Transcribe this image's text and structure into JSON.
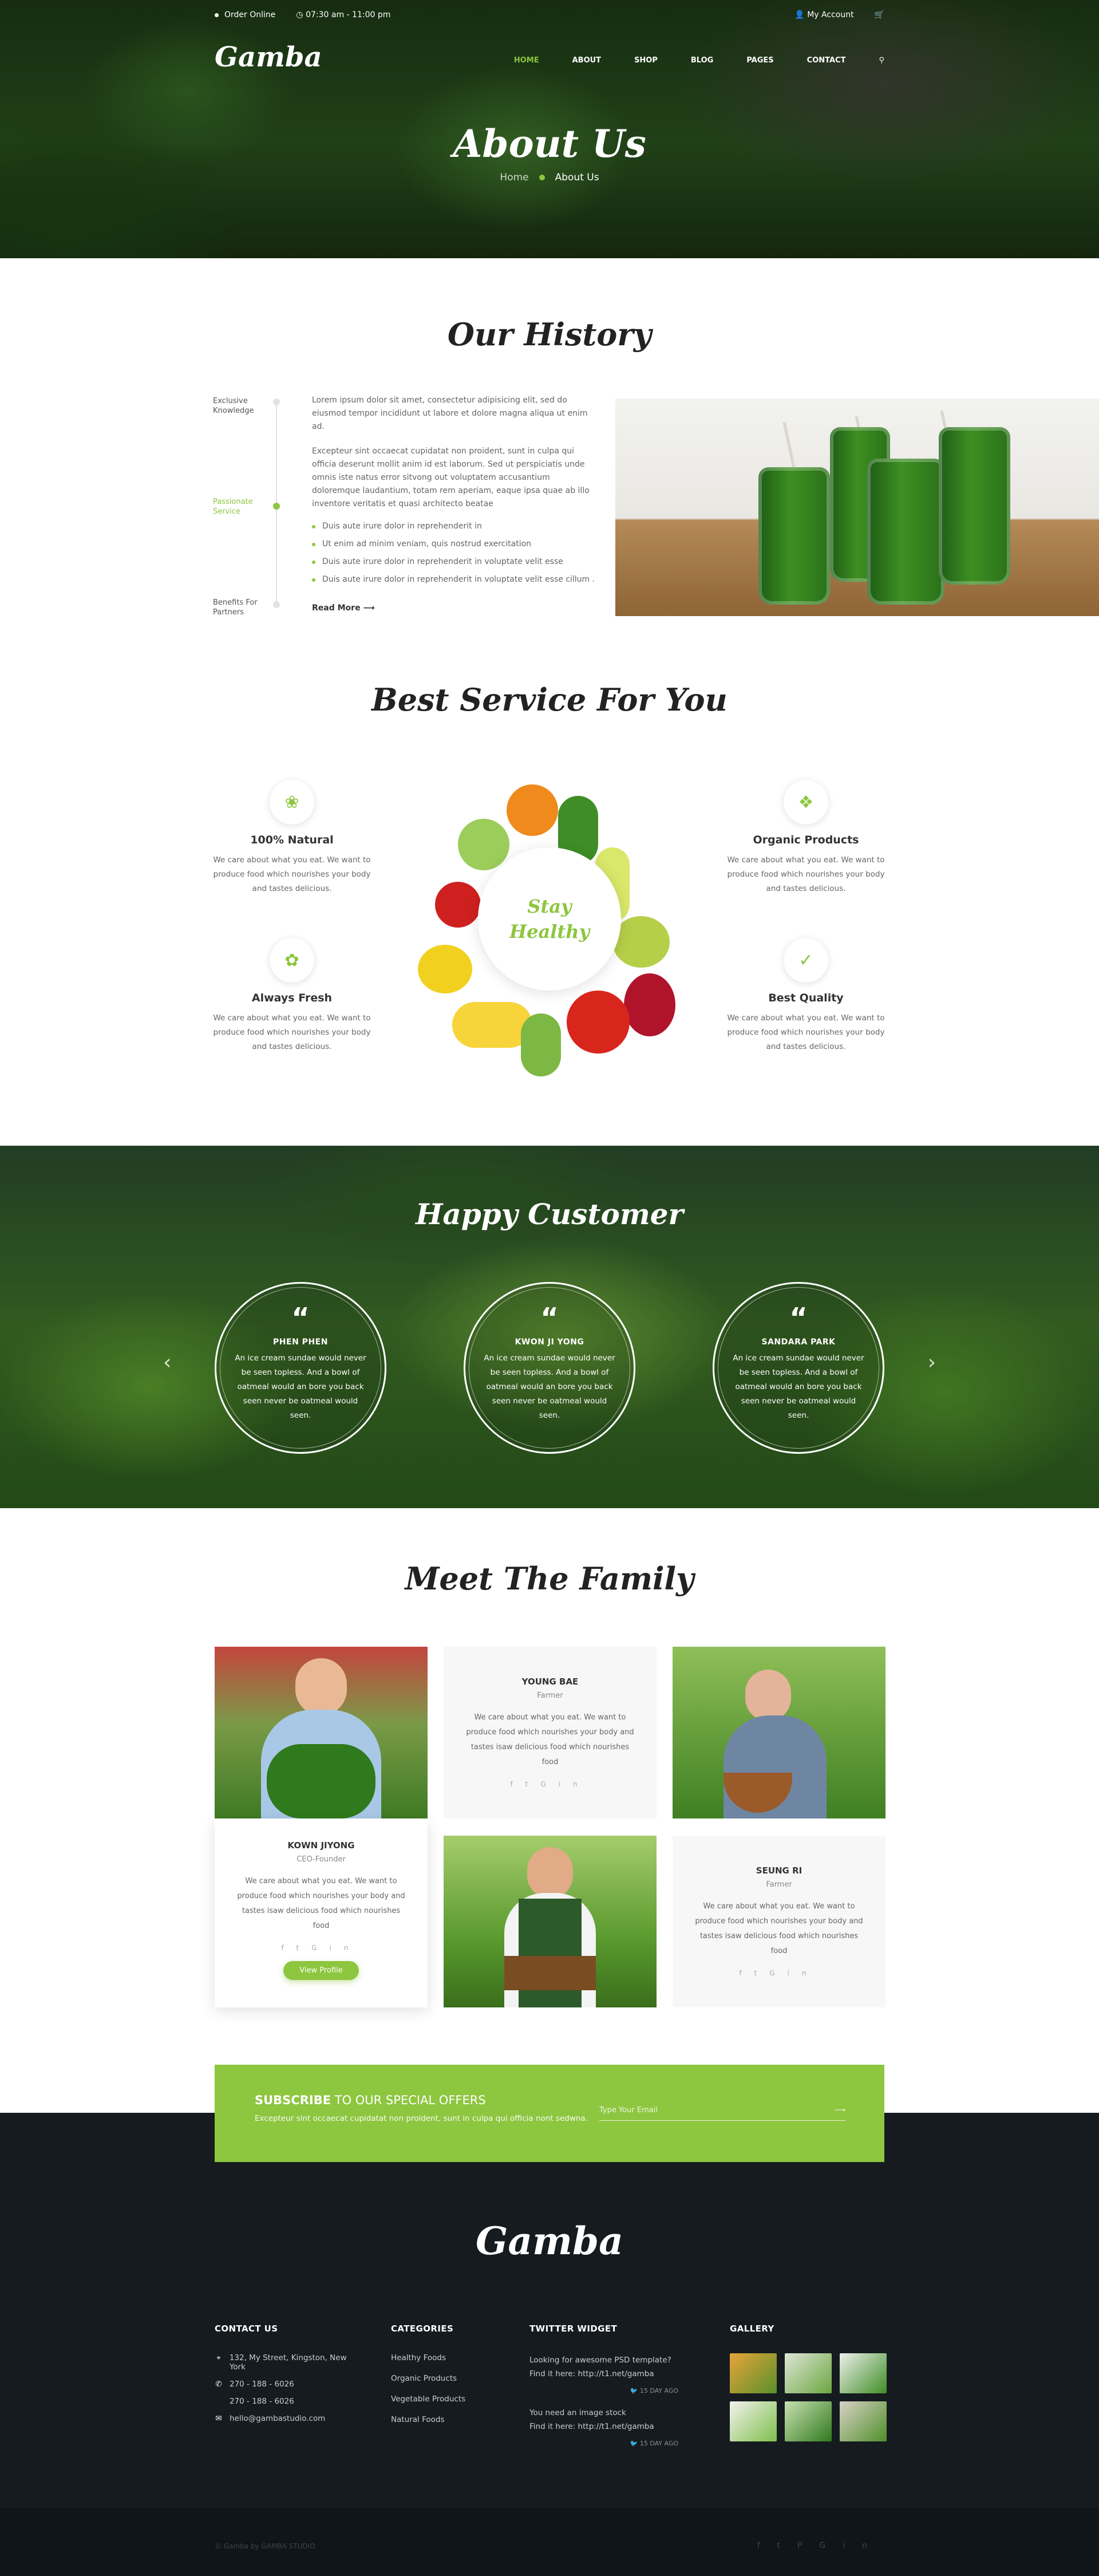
{
  "topbar": {
    "order_online": "Order Online",
    "hours": "07:30 am - 11:00 pm",
    "account": "My Account"
  },
  "brand": {
    "logo": "Gamba"
  },
  "nav": {
    "items": [
      "HOME",
      "ABOUT",
      "SHOP",
      "BLOG",
      "PAGES",
      "CONTACT"
    ],
    "active": "HOME"
  },
  "hero": {
    "title": "About Us",
    "crumb_home": "Home",
    "crumb_current": "About Us"
  },
  "history": {
    "title": "Our History",
    "timeline": [
      "Exclusive Knowledge",
      "Passionate Service",
      "Benefits For Partners"
    ],
    "timeline_active": "Passionate Service",
    "p1": "Lorem ipsum dolor sit amet, consectetur adipisicing elit, sed do eiusmod tempor incididunt ut labore et dolore magna aliqua ut enim ad.",
    "p2": "Excepteur sint occaecat cupidatat non proident, sunt in culpa qui officia deserunt mollit anim id est laborum. Sed ut perspiciatis unde omnis iste natus error sitvong out voluptatem accusantium doloremque laudantium, totam rem aperiam, eaque ipsa quae ab illo inventore veritatis et quasi architecto beatae",
    "bullets": [
      "Duis aute irure dolor in reprehenderit in",
      "Ut enim ad minim veniam, quis nostrud exercitation",
      "Duis aute irure dolor in reprehenderit in voluptate velit esse",
      "Duis aute irure dolor in reprehenderit in voluptate velit esse cillum ."
    ],
    "read_more": "Read More ⟶"
  },
  "service": {
    "title": "Best Service For You",
    "center": "Stay Healthy",
    "items": [
      {
        "title": "100% Natural",
        "text": "We care about what you eat. We want to produce food which nourishes your body and tastes delicious.",
        "icon": "broccoli-icon"
      },
      {
        "title": "Always Fresh",
        "text": "We care about what you eat. We want to produce food which nourishes your body and tastes delicious.",
        "icon": "fresh-veg-icon"
      },
      {
        "title": "Organic Products",
        "text": "We care about what you eat. We want to produce food which nourishes your body and tastes delicious.",
        "icon": "organic-jar-icon"
      },
      {
        "title": "Best Quality",
        "text": "We care about what you eat. We want to produce food which nourishes your body and tastes delicious.",
        "icon": "quality-badge-icon"
      }
    ]
  },
  "customers": {
    "title": "Happy Customer",
    "items": [
      {
        "name": "PHEN PHEN",
        "text": "An ice cream sundae would never be seen topless. And a bowl of oatmeal would an bore you back seen never be oatmeal would seen."
      },
      {
        "name": "KWON JI YONG",
        "text": "An ice cream sundae would never be seen topless. And a bowl of oatmeal would an bore you back seen never be oatmeal would seen."
      },
      {
        "name": "SANDARA PARK",
        "text": "An ice cream sundae would never be seen topless. And a bowl of oatmeal would an bore you back seen never be oatmeal would seen."
      }
    ]
  },
  "family": {
    "title": "Meet The Family",
    "members": [
      {
        "name": "YOUNG BAE",
        "role": "Farmer",
        "text": "We care about what you eat. We want to produce food which nourishes your body and tastes isaw delicious food which nourishes food"
      },
      {
        "name": "KOWN JIYONG",
        "role": "CEO-Founder",
        "text": "We care about what you eat. We want to produce food which nourishes your body and tastes isaw delicious food which nourishes food",
        "button": "View Profile"
      },
      {
        "name": "SEUNG RI",
        "role": "Farmer",
        "text": "We care about what you eat. We want to produce food which nourishes your body and tastes isaw delicious food which nourishes food"
      }
    ]
  },
  "subscribe": {
    "title_bold": "SUBSCRIBE",
    "title_rest": " TO OUR SPECIAL OFFERS",
    "text": "Excepteur sint occaecat cupidatat non proident, sunt in culpa qui officia nont sedwna.",
    "placeholder": "Type Your Email",
    "go": "⟶"
  },
  "footer": {
    "logo": "Gamba",
    "contact": {
      "title": "CONTACT US",
      "address": "132, My Street, Kingston, New York",
      "phone1": "270 - 188 - 6026",
      "phone2": "270 - 188 - 6026",
      "email": "hello@gambastudio.com"
    },
    "categories": {
      "title": "CATEGORIES",
      "items": [
        "Healthy Foods",
        "Organic Products",
        "Vegetable Products",
        "Natural Foods"
      ]
    },
    "twitter": {
      "title": "TWITTER WIDGET",
      "tweets": [
        {
          "line1": "Looking for awesome PSD template?",
          "line2": "Find it here: http://t1.net/gamba",
          "ago": "15 DAY AGO"
        },
        {
          "line1": "You need an image stock",
          "line2": "Find it here: http://t1.net/gamba",
          "ago": "15 DAY AGO"
        }
      ]
    },
    "gallery": {
      "title": "GALLERY"
    },
    "copyright": "© Gamba by GAMBA STUDIO"
  },
  "colors": {
    "accent": "#8dc63f",
    "footer": "#151b1f"
  }
}
